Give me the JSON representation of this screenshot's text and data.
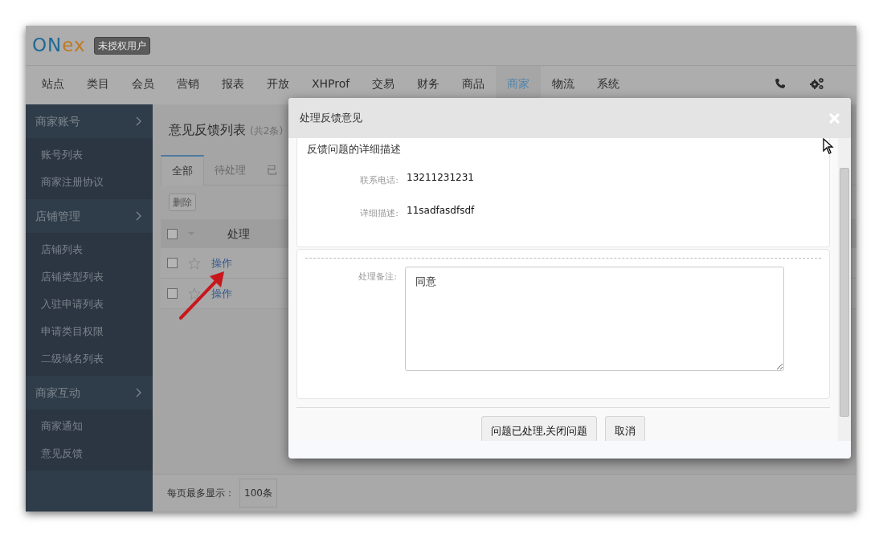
{
  "header": {
    "logo": {
      "primary": "ON",
      "accent": "ex"
    },
    "user_badge": "未授权用户"
  },
  "nav": [
    {
      "label": "站点",
      "selected": false
    },
    {
      "label": "类目",
      "selected": false
    },
    {
      "label": "会员",
      "selected": false
    },
    {
      "label": "营销",
      "selected": false
    },
    {
      "label": "报表",
      "selected": false
    },
    {
      "label": "开放",
      "selected": false
    },
    {
      "label": "XHProf",
      "selected": false
    },
    {
      "label": "交易",
      "selected": false
    },
    {
      "label": "财务",
      "selected": false
    },
    {
      "label": "商品",
      "selected": false
    },
    {
      "label": "商家",
      "selected": true
    },
    {
      "label": "物流",
      "selected": false
    },
    {
      "label": "系统",
      "selected": false
    }
  ],
  "sidebar": [
    {
      "title": "商家账号",
      "items": [
        "账号列表",
        "商家注册协议"
      ]
    },
    {
      "title": "店铺管理",
      "items": [
        "店铺列表",
        "店铺类型列表",
        "入驻申请列表",
        "申请类目权限",
        "二级域名列表"
      ]
    },
    {
      "title": "商家互动",
      "items": [
        "商家通知",
        "意见反馈"
      ]
    }
  ],
  "page": {
    "title": "意见反馈列表",
    "count": "(共2条)",
    "tabs": [
      {
        "label": "全部",
        "selected": true
      },
      {
        "label": "待处理",
        "selected": false
      },
      {
        "label": "已",
        "selected": false
      }
    ],
    "all_selected": false,
    "delete_button": "删除",
    "columns": [
      "处理"
    ],
    "rows": [
      {
        "checked": false,
        "starred": false,
        "action": "操作"
      },
      {
        "checked": false,
        "starred": false,
        "action": "操作"
      }
    ]
  },
  "footer": {
    "label": "每页最多显示：",
    "page_size": "100条"
  },
  "dialog": {
    "title": "处理反馈意见",
    "section_title": "反馈问题的详细描述",
    "fields": [
      {
        "label": "联系电话:",
        "value": "13211231231"
      },
      {
        "label": "详细描述:",
        "value": "11sadfasdfsdf"
      }
    ],
    "remark": {
      "label": "处理备注:",
      "value": "同意"
    },
    "buttons": [
      "问题已处理,关闭问题",
      "取消"
    ]
  }
}
